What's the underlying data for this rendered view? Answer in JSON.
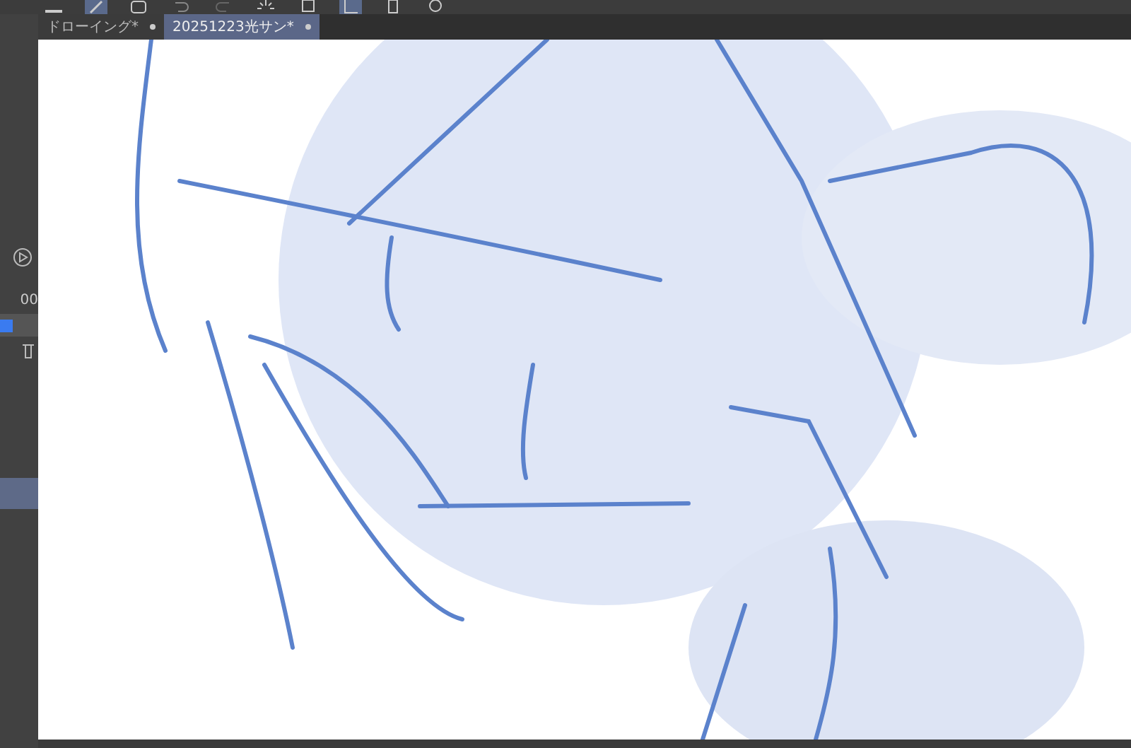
{
  "tabs": [
    {
      "label": "ドローイング*",
      "selected": false
    },
    {
      "label": "20251223光サン*",
      "selected": true
    }
  ],
  "left_panel": {
    "opacity_value": "00"
  }
}
